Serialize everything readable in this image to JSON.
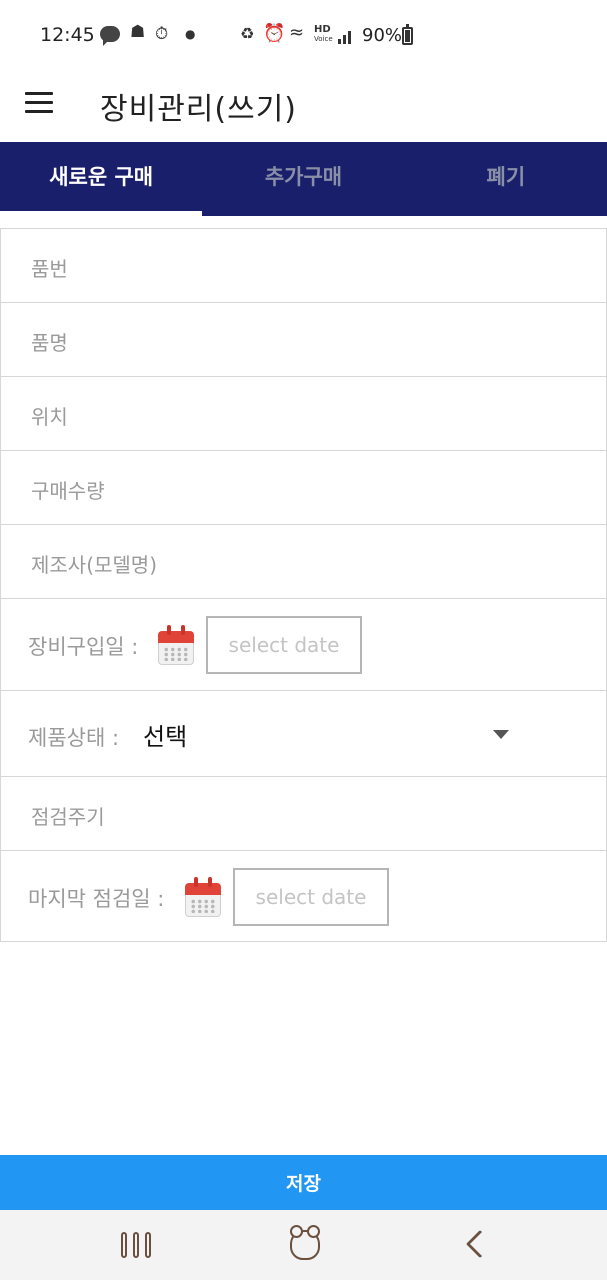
{
  "status_bar": {
    "time": "12:45",
    "battery": "90%",
    "icons": [
      "talk-icon",
      "notification-icon",
      "timer-icon",
      "dot-icon",
      "recycle-icon",
      "alarm-icon",
      "wifi-icon",
      "hd-voice-icon",
      "signal-icon",
      "battery-icon"
    ]
  },
  "app_bar": {
    "title": "장비관리(쓰기)",
    "menu_icon": "hamburger-menu-icon"
  },
  "tabs": [
    {
      "label": "새로운 구매",
      "active": true
    },
    {
      "label": "추가구매",
      "active": false
    },
    {
      "label": "폐기",
      "active": false
    }
  ],
  "form": {
    "part_number_placeholder": "품번",
    "product_name_placeholder": "품명",
    "location_placeholder": "위치",
    "purchase_qty_placeholder": "구매수량",
    "manufacturer_placeholder": "제조사(모델명)",
    "purchase_date_label": "장비구입일 :",
    "purchase_date_placeholder": "select date",
    "product_status_label": "제품상태 :",
    "product_status_value": "선택",
    "inspection_cycle_placeholder": "점검주기",
    "last_inspection_label": "마지막 점검일 :",
    "last_inspection_placeholder": "select date"
  },
  "save_button": {
    "label": "저장"
  },
  "colors": {
    "tab_bar": "#1a1f6b",
    "save_button": "#2196f3",
    "calendar_red": "#e04438",
    "nav_icon": "#6b4f3f"
  }
}
